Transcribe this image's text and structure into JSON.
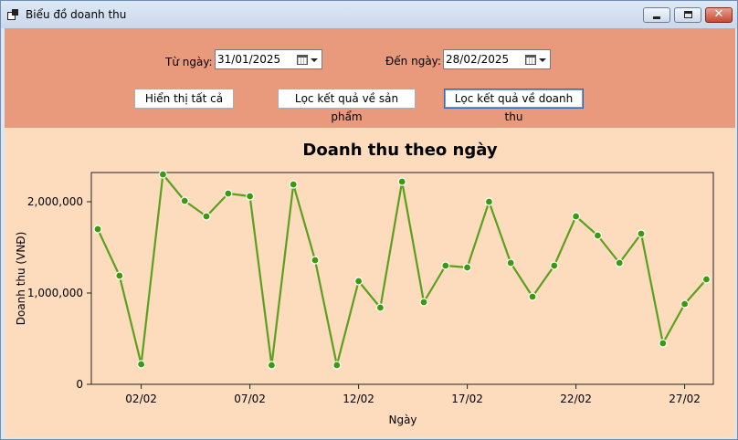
{
  "window": {
    "title": "Biểu đồ doanh thu"
  },
  "filters": {
    "from_label": "Từ ngày:",
    "from_value": "31/01/2025",
    "to_label": "Đến ngày:",
    "to_value": "28/02/2025"
  },
  "buttons": {
    "show_all": "Hiển thị tất cả",
    "filter_product": "Lọc kết quả về sản phẩm",
    "filter_revenue": "Lọc kết quả về doanh thu"
  },
  "colors": {
    "toolbar_bg": "#e99a7c",
    "chart_bg": "#fddbbd",
    "series_line": "#5aa01e",
    "series_point": "#3a9a10"
  },
  "chart_data": {
    "type": "line",
    "title": "Doanh thu theo ngày",
    "xlabel": "Ngày",
    "ylabel": "Doanh thu (VNĐ)",
    "x": [
      "31/01",
      "01/02",
      "02/02",
      "03/02",
      "04/02",
      "05/02",
      "06/02",
      "07/02",
      "08/02",
      "09/02",
      "10/02",
      "11/02",
      "12/02",
      "13/02",
      "14/02",
      "15/02",
      "16/02",
      "17/02",
      "18/02",
      "19/02",
      "20/02",
      "21/02",
      "22/02",
      "23/02",
      "24/02",
      "25/02",
      "26/02",
      "27/02",
      "28/02"
    ],
    "series": [
      {
        "values": [
          1700000,
          1190000,
          220000,
          2300000,
          2010000,
          1840000,
          2090000,
          2060000,
          210000,
          2190000,
          1360000,
          210000,
          1130000,
          840000,
          2220000,
          900000,
          1300000,
          1280000,
          2000000,
          1330000,
          960000,
          1300000,
          1840000,
          1630000,
          1330000,
          1650000,
          450000,
          880000,
          1150000
        ]
      }
    ],
    "xticks": [
      "02/02",
      "07/02",
      "12/02",
      "17/02",
      "22/02",
      "27/02"
    ],
    "yticks": [
      "0",
      "1,000,000",
      "2,000,000"
    ],
    "ylim": [
      0,
      2300000
    ],
    "grid": false,
    "legend": "none"
  }
}
